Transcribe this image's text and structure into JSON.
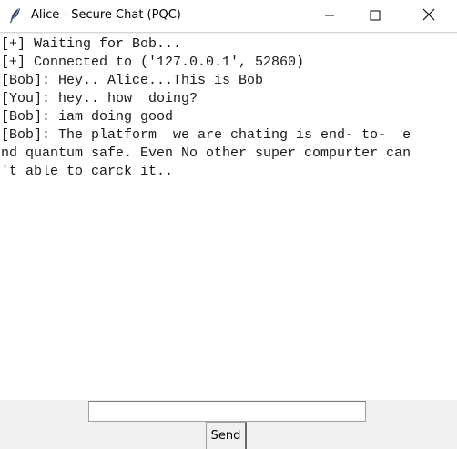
{
  "window": {
    "title": "Alice - Secure Chat (PQC)",
    "icon": "feather-icon",
    "controls": [
      "minimize-icon",
      "maximize-icon",
      "close-icon"
    ]
  },
  "chat": {
    "lines": [
      "[+] Waiting for Bob...",
      "[+] Connected to ('127.0.0.1', 52860)",
      "[Bob]: Hey.. Alice...This is Bob",
      "[You]: hey.. how  doing?",
      "[Bob]: iam doing good",
      "[Bob]: The platform  we are chating is end- to-  e",
      "nd quantum safe. Even No other super compurter can",
      "'t able to carck it.."
    ]
  },
  "input": {
    "value": "",
    "placeholder": ""
  },
  "send_button": {
    "label": "Send"
  }
}
